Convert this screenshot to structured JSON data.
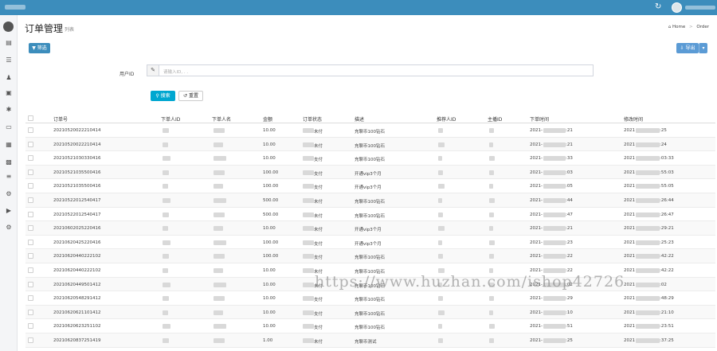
{
  "header": {
    "refresh_icon": "refresh-icon",
    "user_avatar_icon": "avatar"
  },
  "sidebar": {
    "icons": [
      "dashboard-icon",
      "list-icon",
      "users-icon",
      "order-icon",
      "settings-icon",
      "card-icon",
      "image-icon",
      "chart-icon",
      "menu-icon",
      "gear-icon",
      "video-icon",
      "cog-icon"
    ]
  },
  "page": {
    "title": "订单管理",
    "subtitle": "列表",
    "breadcrumb": [
      "Home",
      "Order"
    ]
  },
  "toolbar": {
    "filter_label": "筛选",
    "export_label": "导出"
  },
  "filter": {
    "user_id_label": "用户ID",
    "user_id_placeholder": "请输入ID, . .",
    "search_label": "搜索",
    "reset_label": "重置"
  },
  "table": {
    "columns": [
      "订单号",
      "下单人ID",
      "下单人名",
      "金额",
      "订单状态",
      "描述",
      "推荐人ID",
      "主播ID",
      "下单时间",
      "修改时间"
    ],
    "rows": [
      {
        "order_no": "20210520022210414",
        "amount": "10.00",
        "status": "未付",
        "desc": "充聊币100钻石",
        "created": "2021-",
        "created_tail": ":21",
        "updated": "2021",
        "updated_tail": ":25"
      },
      {
        "order_no": "20210520022210414",
        "amount": "10.00",
        "status": "未付",
        "desc": "充聊币100钻石",
        "created": "2021-",
        "created_tail": ":21",
        "updated": "2021",
        "updated_tail": ":24"
      },
      {
        "order_no": "20210521030330416",
        "amount": "10.00",
        "status": "支付",
        "desc": "充聊币100钻石",
        "created": "2021-",
        "created_tail": ":33",
        "updated": "2021",
        "updated_tail": ":03:33"
      },
      {
        "order_no": "20210521035500416",
        "amount": "100.00",
        "status": "支付",
        "desc": "开通vip3个月",
        "created": "2021-",
        "created_tail": ":03",
        "updated": "2021",
        "updated_tail": ":55:03"
      },
      {
        "order_no": "20210521035500416",
        "amount": "100.00",
        "status": "支付",
        "desc": "开通vip3个月",
        "created": "2021-",
        "created_tail": ":05",
        "updated": "2021",
        "updated_tail": ":55:05"
      },
      {
        "order_no": "20210522012540417",
        "amount": "500.00",
        "status": "未付",
        "desc": "充聊币100钻石",
        "created": "2021-",
        "created_tail": ":44",
        "updated": "2021",
        "updated_tail": ":26:44"
      },
      {
        "order_no": "20210522012540417",
        "amount": "500.00",
        "status": "未付",
        "desc": "充聊币100钻石",
        "created": "2021-",
        "created_tail": ":47",
        "updated": "2021",
        "updated_tail": ":26:47"
      },
      {
        "order_no": "20210602025220416",
        "amount": "10.00",
        "status": "未付",
        "desc": "开通vip3个月",
        "created": "2021-",
        "created_tail": ":21",
        "updated": "2021",
        "updated_tail": ":29:21"
      },
      {
        "order_no": "20210620425220416",
        "amount": "100.00",
        "status": "支付",
        "desc": "开通vip3个月",
        "created": "2021-",
        "created_tail": ":23",
        "updated": "2021",
        "updated_tail": ":25:23"
      },
      {
        "order_no": "20210620440222102",
        "amount": "100.00",
        "status": "支付",
        "desc": "充聊币100钻石",
        "created": "2021-",
        "created_tail": ":22",
        "updated": "2021",
        "updated_tail": ":42:22"
      },
      {
        "order_no": "20210620440222102",
        "amount": "10.00",
        "status": "未付",
        "desc": "充聊币100钻石",
        "created": "2021-",
        "created_tail": ":22",
        "updated": "2021",
        "updated_tail": ":42:22"
      },
      {
        "order_no": "20210620449501412",
        "amount": "10.00",
        "status": "未付",
        "desc": "充聊币100钻石",
        "created": "2021-",
        "created_tail": ":02",
        "updated": "2021",
        "updated_tail": ":02"
      },
      {
        "order_no": "20210620548291412",
        "amount": "10.00",
        "status": "支付",
        "desc": "充聊币100钻石",
        "created": "2021-",
        "created_tail": ":29",
        "updated": "2021",
        "updated_tail": ":48:29"
      },
      {
        "order_no": "20210620621101412",
        "amount": "10.00",
        "status": "支付",
        "desc": "充聊币100钻石",
        "created": "2021-",
        "created_tail": ":10",
        "updated": "2021",
        "updated_tail": ":21:10"
      },
      {
        "order_no": "20210620623251102",
        "amount": "10.00",
        "status": "支付",
        "desc": "充聊币100钻石",
        "created": "2021-",
        "created_tail": ":51",
        "updated": "2021",
        "updated_tail": ":23:51"
      },
      {
        "order_no": "20210620837251419",
        "amount": "1.00",
        "status": "未付",
        "desc": "充聊币测试",
        "created": "2021-",
        "created_tail": ":25",
        "updated": "2021",
        "updated_tail": ":37:25"
      }
    ]
  },
  "watermark": "https://www.huzhan.com/ishop42726"
}
